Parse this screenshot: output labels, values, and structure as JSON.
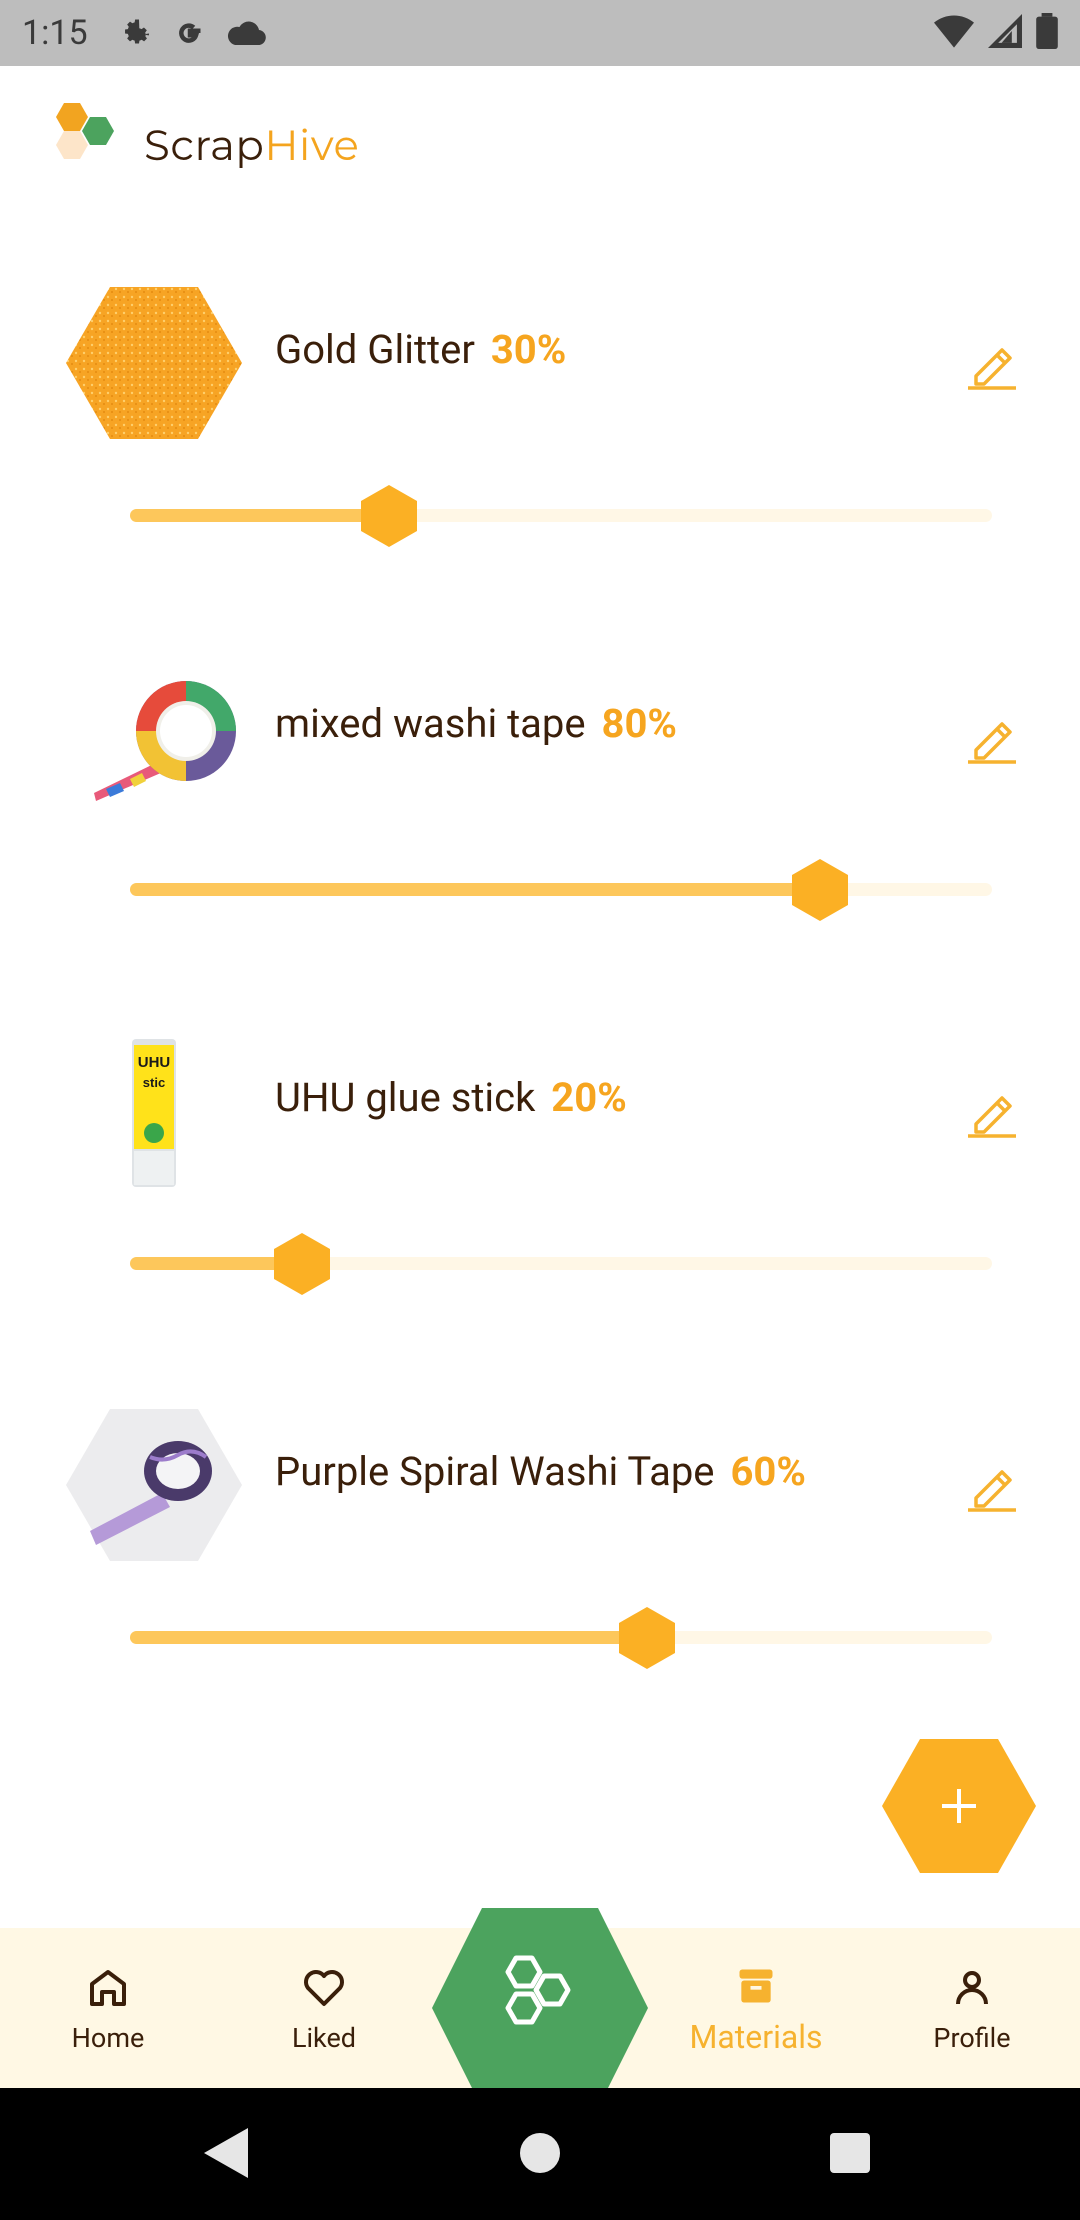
{
  "status_bar": {
    "time": "1:15",
    "icons_left": [
      "settings-icon",
      "google-icon",
      "cloud-icon"
    ],
    "icons_right": [
      "wifi-icon",
      "signal-icon",
      "battery-icon"
    ]
  },
  "header": {
    "logo_icon": "honeycomb-logo-icon",
    "brand_part1": "Scrap",
    "brand_part2": "Hive"
  },
  "materials": [
    {
      "name": "Gold Glitter",
      "percent_label": "30%",
      "level": 0.3,
      "thumb_icon": "gold-glitter-hex-icon"
    },
    {
      "name": "mixed washi tape",
      "percent_label": "80%",
      "level": 0.8,
      "thumb_icon": "washi-tape-roll-icon"
    },
    {
      "name": "UHU glue stick",
      "percent_label": "20%",
      "level": 0.2,
      "thumb_icon": "glue-stick-icon"
    },
    {
      "name": "Purple Spiral Washi Tape",
      "percent_label": "60%",
      "level": 0.6,
      "thumb_icon": "purple-washi-hex-icon"
    }
  ],
  "edit_icon": "pencil-icon",
  "fab": {
    "icon": "plus-icon"
  },
  "bottom_nav": {
    "items": [
      {
        "label": "Home",
        "icon": "home-icon"
      },
      {
        "label": "Liked",
        "icon": "heart-icon"
      },
      {
        "label": "Materials",
        "icon": "box-icon",
        "active": true
      },
      {
        "label": "Profile",
        "icon": "person-icon"
      }
    ],
    "center_icon": "honeycomb-icon"
  },
  "colors": {
    "accent": "#fbb024",
    "green": "#4ca35e",
    "text_dark": "#3a1f0a",
    "slider_fill": "#fdc75b",
    "slider_track": "#fff7e6",
    "nav_bg": "#fff8e4"
  }
}
